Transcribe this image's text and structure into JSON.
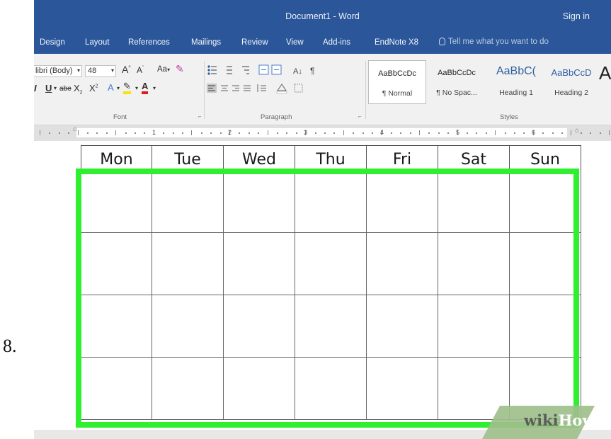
{
  "step_number": "8.",
  "window": {
    "title": "Document1 - Word",
    "sign_in": "Sign in"
  },
  "tabs": [
    {
      "label": "Design"
    },
    {
      "label": "Layout"
    },
    {
      "label": "References"
    },
    {
      "label": "Mailings"
    },
    {
      "label": "Review"
    },
    {
      "label": "View"
    },
    {
      "label": "Add-ins"
    },
    {
      "label": "EndNote X8"
    }
  ],
  "tell_me": "Tell me what you want to do",
  "ribbon": {
    "font_name": "libri (Body)",
    "font_size": "48",
    "change_case": "Aa",
    "strikethrough": "abe",
    "subscript": "X",
    "superscript": "X",
    "font_color_letter": "A",
    "group_font": "Font",
    "group_paragraph": "Paragraph",
    "group_styles": "Styles",
    "styles": [
      {
        "sample": "AaBbCcDc",
        "name": "¶ Normal"
      },
      {
        "sample": "AaBbCcDc",
        "name": "¶ No Spac..."
      },
      {
        "sample": "AaBbC(",
        "name": "Heading 1"
      },
      {
        "sample": "AaBbCcD",
        "name": "Heading 2"
      }
    ],
    "style_more": "A"
  },
  "ruler": {
    "numbers": [
      "1",
      "2",
      "3",
      "4",
      "5",
      "6"
    ]
  },
  "calendar": {
    "days": [
      "Mon",
      "Tue",
      "Wed",
      "Thu",
      "Fri",
      "Sat",
      "Sun"
    ],
    "rows": 4
  },
  "watermark": {
    "part1": "wiki",
    "part2": "How"
  },
  "colors": {
    "word_blue": "#2b579a",
    "highlight_green": "#2ef02f"
  }
}
